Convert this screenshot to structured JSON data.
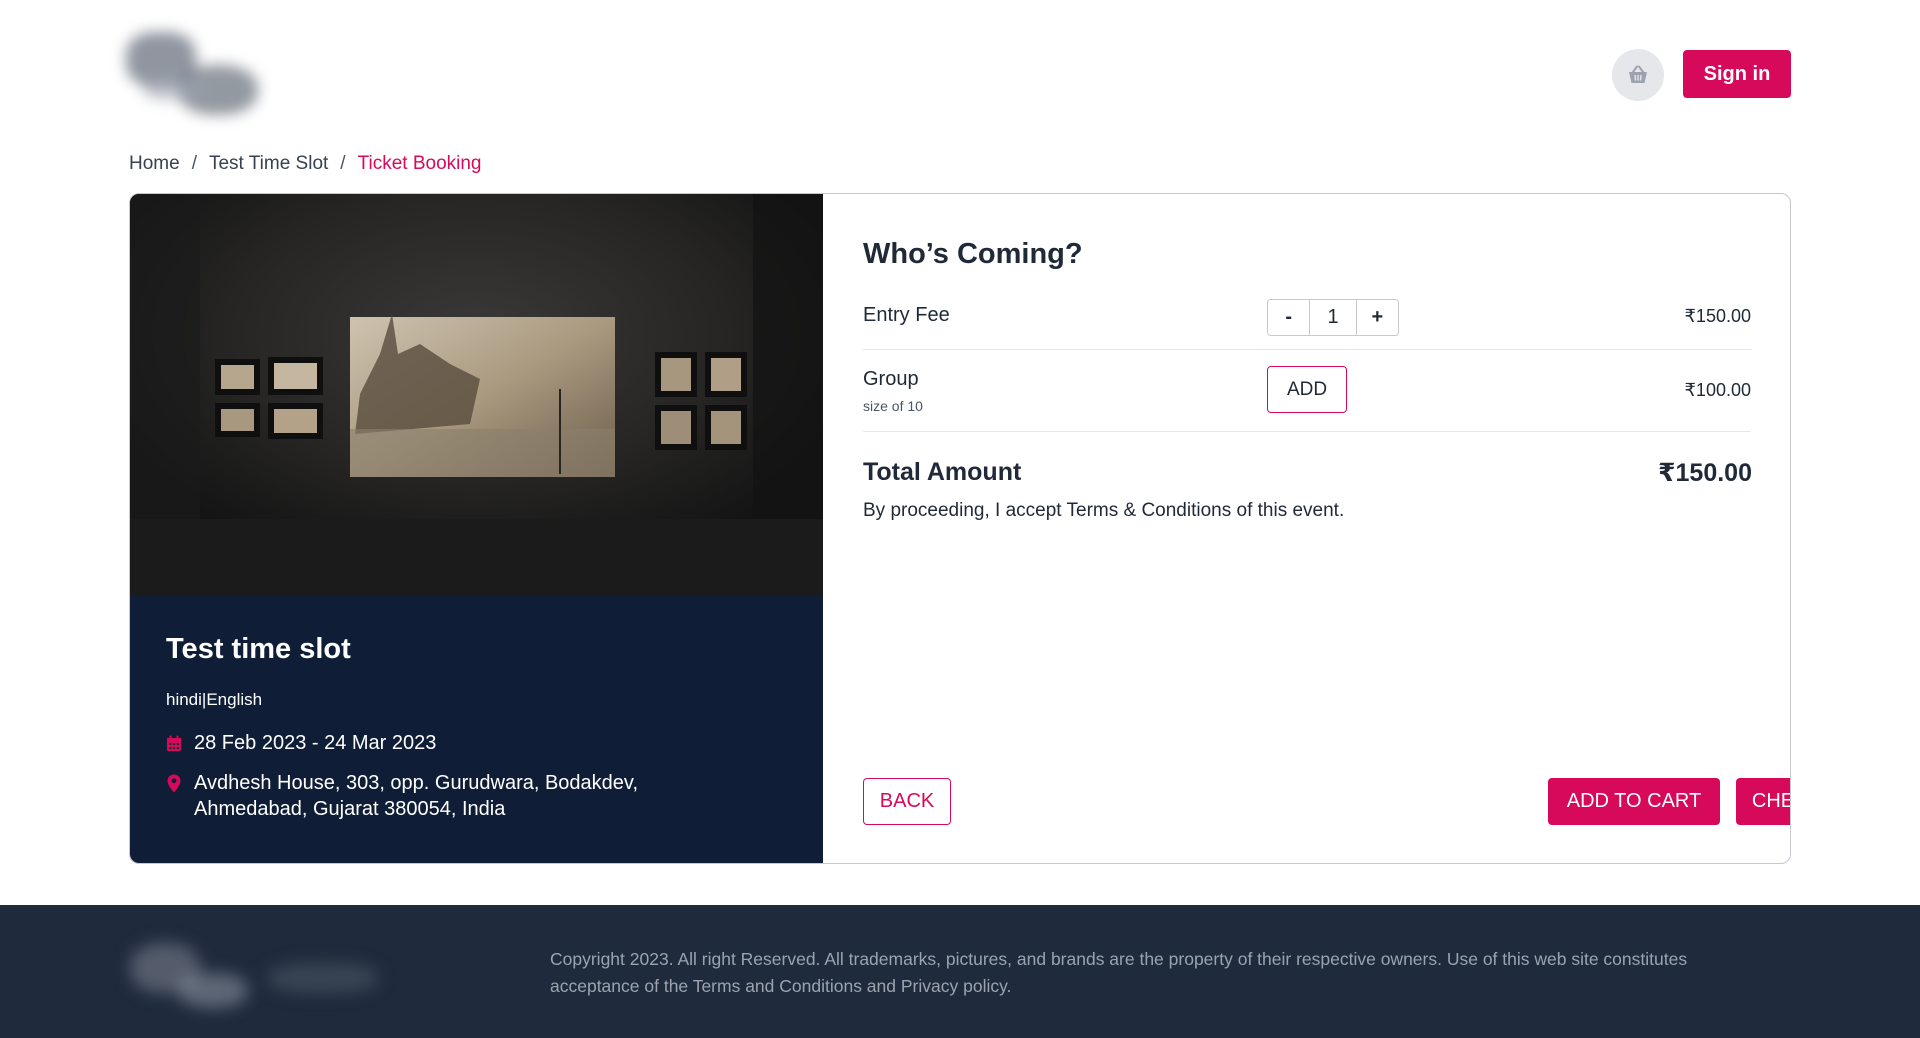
{
  "header": {
    "cart_icon": "cart-icon",
    "signin_label": "Sign in"
  },
  "breadcrumb": {
    "items": [
      "Home",
      "Test Time Slot",
      "Ticket Booking"
    ],
    "separator": "/"
  },
  "event": {
    "title": "Test time slot",
    "languages": "hindi|English",
    "dates": "28 Feb 2023 - 24 Mar 2023",
    "address_line1": "Avdhesh House, 303, opp. Gurudwara, Bodakdev,",
    "address_line2": "Ahmedabad, Gujarat 380054, India",
    "calendar_icon": "calendar-icon",
    "location_icon": "location-pin-icon"
  },
  "booking": {
    "title": "Who’s Coming?",
    "tickets": [
      {
        "label": "Entry Fee",
        "quantity": "1",
        "price": "₹150.00",
        "minus": "-",
        "plus": "+"
      },
      {
        "label": "Group",
        "sublabel": "size of 10",
        "add_label": "ADD",
        "price": "₹100.00"
      }
    ],
    "total_label": "Total Amount",
    "total_value": "₹150.00",
    "terms": "By proceeding, I accept Terms & Conditions of this event.",
    "back_label": "BACK",
    "add_to_cart_label": "ADD TO CART",
    "checkout_label": "CHECKOUT"
  },
  "footer": {
    "copyright": "Copyright 2023. All right Reserved. All trademarks, pictures, and brands are the property of their respective owners. Use of this web site constitutes acceptance of the Terms and Conditions and Privacy policy."
  },
  "colors": {
    "accent": "#d6095b",
    "event_panel": "#0f1e36",
    "footer_bg": "#1f2a3c"
  }
}
